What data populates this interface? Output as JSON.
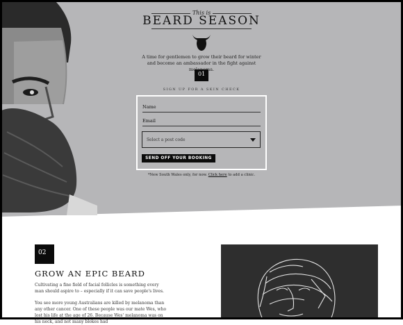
{
  "hero": {
    "pre_title": "This is",
    "title": "BEARD SEASON",
    "intro": "A time for gentlemen to grow their beard for winter and become an ambassador in the fight against melanoma.",
    "step_number": "01",
    "signup_label": "SIGN UP FOR A SKIN CHECK",
    "form": {
      "name_label": "Name",
      "email_label": "Email",
      "postcode_select": "Select a post code",
      "submit_label": "SEND OFF YOUR BOOKING"
    },
    "footnote_prefix": "*New South Wales only, for now.",
    "footnote_link": "Click here",
    "footnote_suffix": "to add a clinic."
  },
  "section2": {
    "step_number": "02",
    "title": "GROW AN EPIC BEARD",
    "para1": "Cultivating a fine field of facial follicles is something every man should aspire to – especially if it can save people's lives.",
    "para2": "You see more young Australians are killed by melanoma than any other cancer. One of these people was our mate Wes, who lost his life at the age of 26. Because Wes' melanoma was on his neck, and not many blokes had"
  },
  "colors": {
    "hero_bg": "#b6b6b8",
    "ink": "#0b0b0b",
    "page_bg": "#ffffff"
  }
}
